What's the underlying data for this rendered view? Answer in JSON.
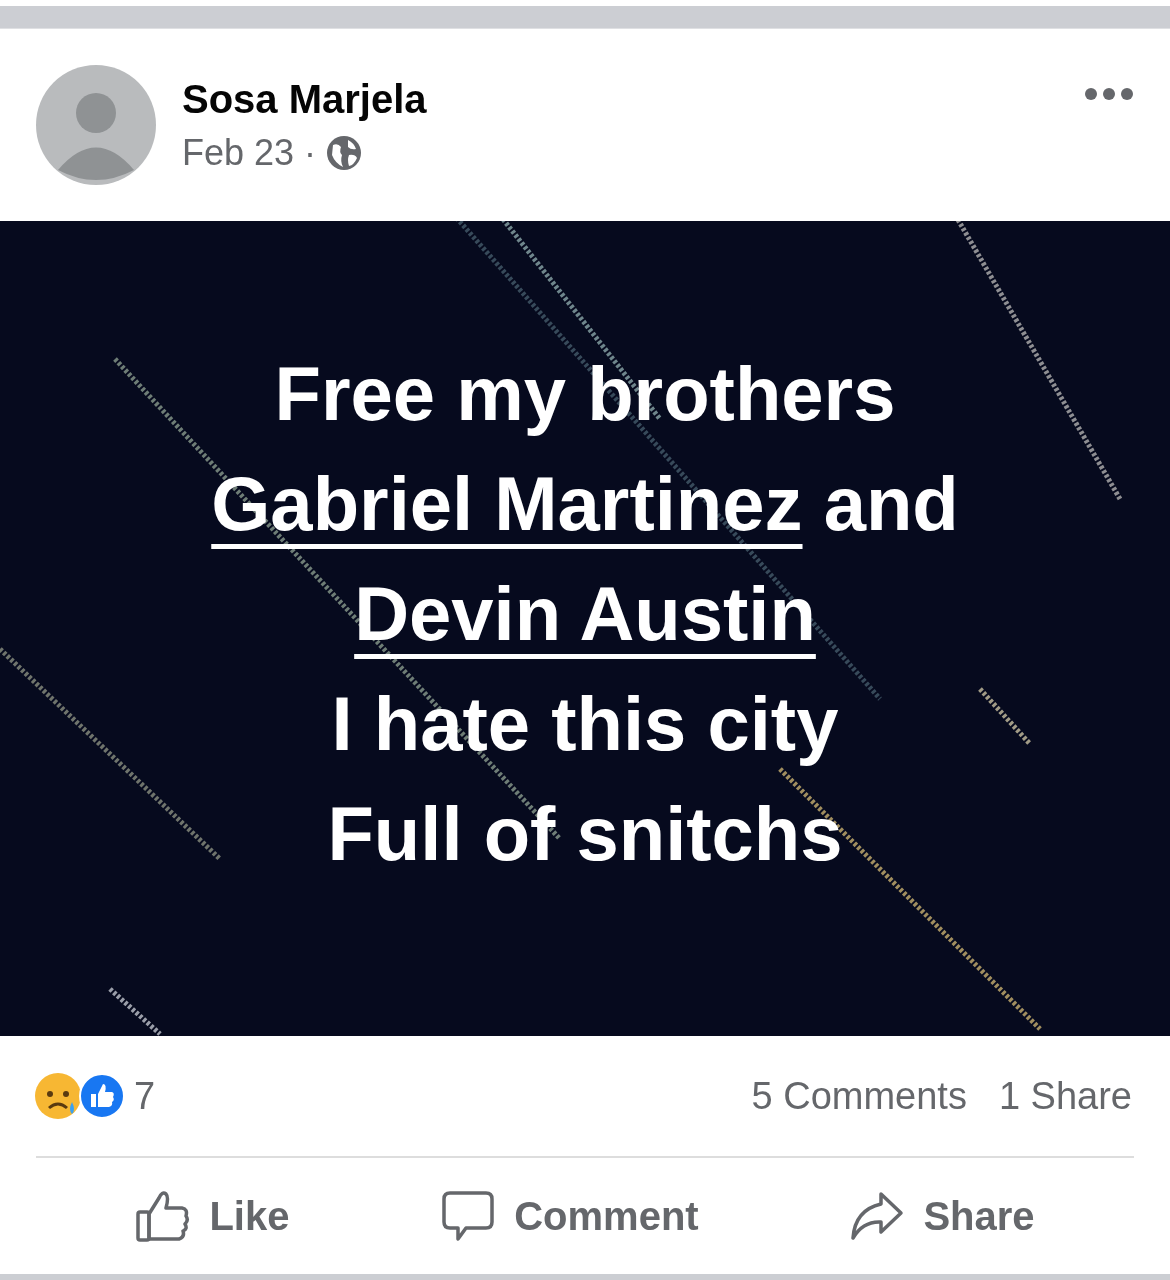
{
  "post": {
    "author": "Sosa Marjela",
    "date": "Feb 23",
    "separator": "·",
    "public": true,
    "text_lines": [
      [
        {
          "kind": "plain",
          "text": "Free my brothers"
        }
      ],
      [
        {
          "kind": "tag",
          "text": "Gabriel Martinez"
        },
        {
          "kind": "plain",
          "text": " and"
        }
      ],
      [
        {
          "kind": "tag",
          "text": "Devin Austin"
        }
      ],
      [
        {
          "kind": "plain",
          "text": "I hate this city"
        }
      ],
      [
        {
          "kind": "plain",
          "text": "Full of snitchs"
        }
      ]
    ],
    "reactions": {
      "count": "7",
      "comments": "5 Comments",
      "shares": "1 Share"
    },
    "actions": [
      {
        "kind": "like",
        "label": "Like"
      },
      {
        "kind": "comment",
        "label": "Comment"
      },
      {
        "kind": "share",
        "label": "Share"
      }
    ]
  }
}
